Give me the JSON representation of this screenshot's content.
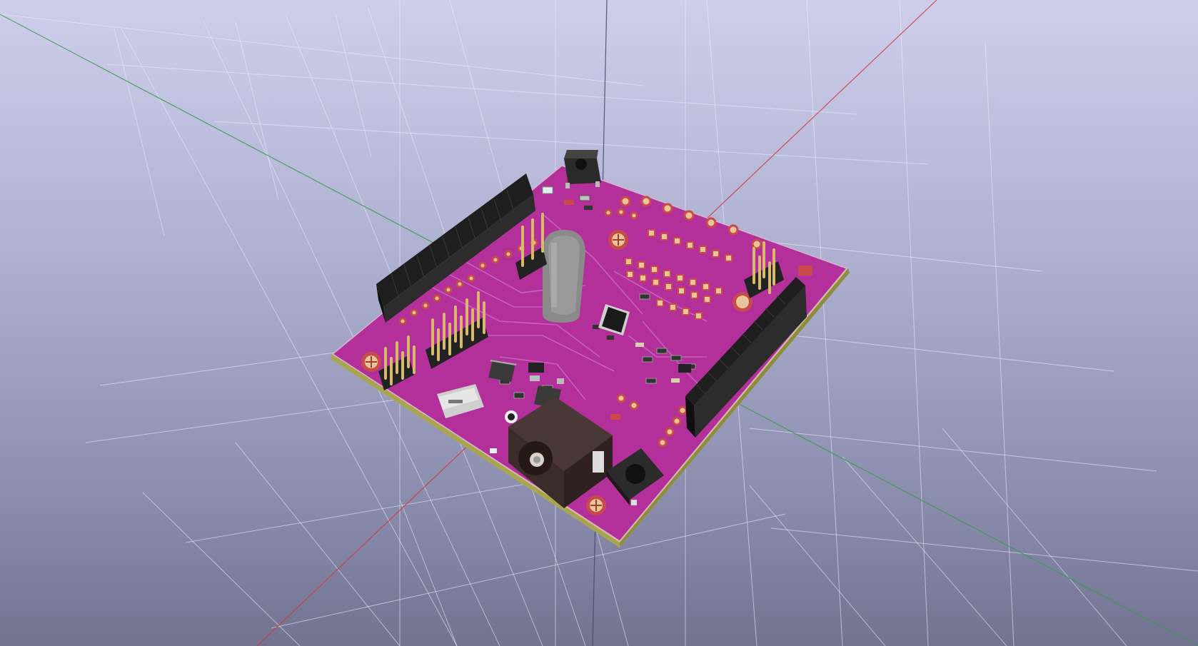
{
  "app": {
    "view": "3D viewer",
    "background_top": "#ceceec",
    "background_bottom": "#727391"
  },
  "scene": {
    "grid": true,
    "grid_color": "#eeeeff",
    "axes": {
      "x_axis_color": "#d03a3a",
      "y_axis_color": "#3a9a4a",
      "z_axis_color": "#4a4a6a"
    },
    "board": {
      "type": "pcb",
      "soldermask_color": "#b3309a",
      "substrate_color": "#cfc96a",
      "silkscreen_color": "#ffffff",
      "components": [
        "header-socket-left",
        "header-socket-right",
        "crystal",
        "microcontroller-qfp",
        "usb-micro-connector",
        "dc-power-jack",
        "reset-button-top",
        "tactile-button-bottom",
        "pin-header-2x3-a",
        "pin-header-2x3-b",
        "pin-header-2x3-c",
        "pin-header-2x3-d",
        "voltage-regulator-sot223",
        "smd-ic-soic",
        "led",
        "smd-passives",
        "mounting-holes",
        "pad-array"
      ]
    }
  }
}
